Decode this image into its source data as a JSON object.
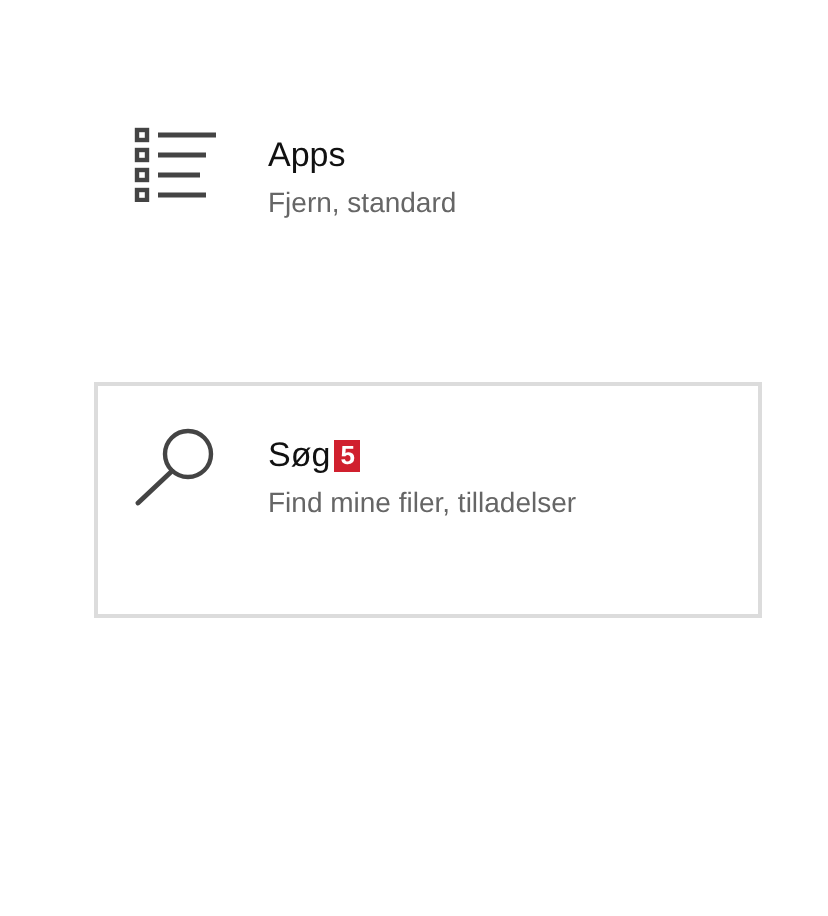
{
  "tiles": [
    {
      "kind": "list",
      "title": "Apps",
      "subtitle": "Fjern, standard",
      "selected": false
    },
    {
      "kind": "search",
      "title": "Søg",
      "badge": "5",
      "subtitle": "Find mine filer, tilladelser",
      "selected": true
    }
  ]
}
